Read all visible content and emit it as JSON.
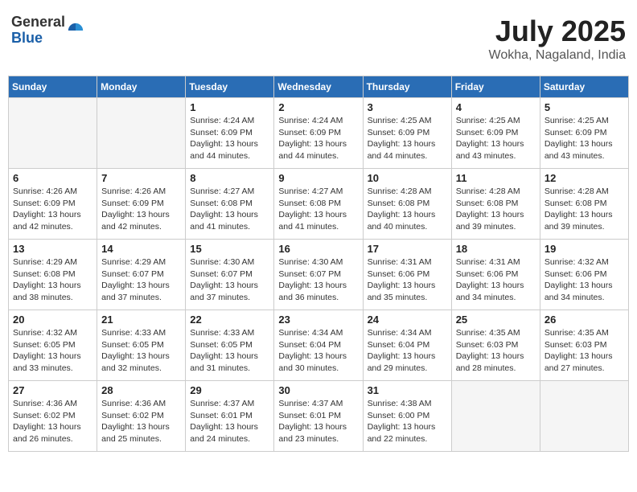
{
  "header": {
    "logo_general": "General",
    "logo_blue": "Blue",
    "month_year": "July 2025",
    "location": "Wokha, Nagaland, India"
  },
  "weekdays": [
    "Sunday",
    "Monday",
    "Tuesday",
    "Wednesday",
    "Thursday",
    "Friday",
    "Saturday"
  ],
  "weeks": [
    [
      {
        "day": "",
        "info": ""
      },
      {
        "day": "",
        "info": ""
      },
      {
        "day": "1",
        "info": "Sunrise: 4:24 AM\nSunset: 6:09 PM\nDaylight: 13 hours and 44 minutes."
      },
      {
        "day": "2",
        "info": "Sunrise: 4:24 AM\nSunset: 6:09 PM\nDaylight: 13 hours and 44 minutes."
      },
      {
        "day": "3",
        "info": "Sunrise: 4:25 AM\nSunset: 6:09 PM\nDaylight: 13 hours and 44 minutes."
      },
      {
        "day": "4",
        "info": "Sunrise: 4:25 AM\nSunset: 6:09 PM\nDaylight: 13 hours and 43 minutes."
      },
      {
        "day": "5",
        "info": "Sunrise: 4:25 AM\nSunset: 6:09 PM\nDaylight: 13 hours and 43 minutes."
      }
    ],
    [
      {
        "day": "6",
        "info": "Sunrise: 4:26 AM\nSunset: 6:09 PM\nDaylight: 13 hours and 42 minutes."
      },
      {
        "day": "7",
        "info": "Sunrise: 4:26 AM\nSunset: 6:09 PM\nDaylight: 13 hours and 42 minutes."
      },
      {
        "day": "8",
        "info": "Sunrise: 4:27 AM\nSunset: 6:08 PM\nDaylight: 13 hours and 41 minutes."
      },
      {
        "day": "9",
        "info": "Sunrise: 4:27 AM\nSunset: 6:08 PM\nDaylight: 13 hours and 41 minutes."
      },
      {
        "day": "10",
        "info": "Sunrise: 4:28 AM\nSunset: 6:08 PM\nDaylight: 13 hours and 40 minutes."
      },
      {
        "day": "11",
        "info": "Sunrise: 4:28 AM\nSunset: 6:08 PM\nDaylight: 13 hours and 39 minutes."
      },
      {
        "day": "12",
        "info": "Sunrise: 4:28 AM\nSunset: 6:08 PM\nDaylight: 13 hours and 39 minutes."
      }
    ],
    [
      {
        "day": "13",
        "info": "Sunrise: 4:29 AM\nSunset: 6:08 PM\nDaylight: 13 hours and 38 minutes."
      },
      {
        "day": "14",
        "info": "Sunrise: 4:29 AM\nSunset: 6:07 PM\nDaylight: 13 hours and 37 minutes."
      },
      {
        "day": "15",
        "info": "Sunrise: 4:30 AM\nSunset: 6:07 PM\nDaylight: 13 hours and 37 minutes."
      },
      {
        "day": "16",
        "info": "Sunrise: 4:30 AM\nSunset: 6:07 PM\nDaylight: 13 hours and 36 minutes."
      },
      {
        "day": "17",
        "info": "Sunrise: 4:31 AM\nSunset: 6:06 PM\nDaylight: 13 hours and 35 minutes."
      },
      {
        "day": "18",
        "info": "Sunrise: 4:31 AM\nSunset: 6:06 PM\nDaylight: 13 hours and 34 minutes."
      },
      {
        "day": "19",
        "info": "Sunrise: 4:32 AM\nSunset: 6:06 PM\nDaylight: 13 hours and 34 minutes."
      }
    ],
    [
      {
        "day": "20",
        "info": "Sunrise: 4:32 AM\nSunset: 6:05 PM\nDaylight: 13 hours and 33 minutes."
      },
      {
        "day": "21",
        "info": "Sunrise: 4:33 AM\nSunset: 6:05 PM\nDaylight: 13 hours and 32 minutes."
      },
      {
        "day": "22",
        "info": "Sunrise: 4:33 AM\nSunset: 6:05 PM\nDaylight: 13 hours and 31 minutes."
      },
      {
        "day": "23",
        "info": "Sunrise: 4:34 AM\nSunset: 6:04 PM\nDaylight: 13 hours and 30 minutes."
      },
      {
        "day": "24",
        "info": "Sunrise: 4:34 AM\nSunset: 6:04 PM\nDaylight: 13 hours and 29 minutes."
      },
      {
        "day": "25",
        "info": "Sunrise: 4:35 AM\nSunset: 6:03 PM\nDaylight: 13 hours and 28 minutes."
      },
      {
        "day": "26",
        "info": "Sunrise: 4:35 AM\nSunset: 6:03 PM\nDaylight: 13 hours and 27 minutes."
      }
    ],
    [
      {
        "day": "27",
        "info": "Sunrise: 4:36 AM\nSunset: 6:02 PM\nDaylight: 13 hours and 26 minutes."
      },
      {
        "day": "28",
        "info": "Sunrise: 4:36 AM\nSunset: 6:02 PM\nDaylight: 13 hours and 25 minutes."
      },
      {
        "day": "29",
        "info": "Sunrise: 4:37 AM\nSunset: 6:01 PM\nDaylight: 13 hours and 24 minutes."
      },
      {
        "day": "30",
        "info": "Sunrise: 4:37 AM\nSunset: 6:01 PM\nDaylight: 13 hours and 23 minutes."
      },
      {
        "day": "31",
        "info": "Sunrise: 4:38 AM\nSunset: 6:00 PM\nDaylight: 13 hours and 22 minutes."
      },
      {
        "day": "",
        "info": ""
      },
      {
        "day": "",
        "info": ""
      }
    ]
  ]
}
